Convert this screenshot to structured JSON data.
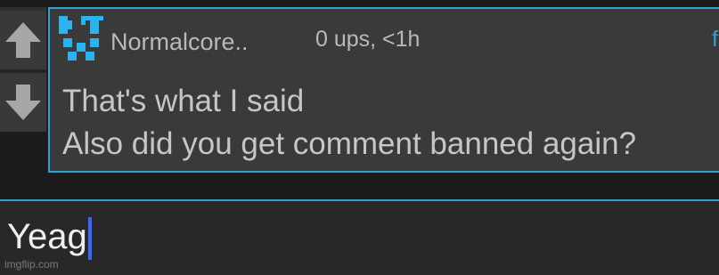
{
  "colors": {
    "accent": "#2aa3d8",
    "card_bg": "#3a3a3a",
    "input_bg": "#282828",
    "caret": "#3a66ff"
  },
  "vote": {
    "up_icon": "arrow-up-icon",
    "down_icon": "arrow-down-icon"
  },
  "comment": {
    "username": "Normalcore..",
    "meta": "0 ups, <1h",
    "flag_label": "f",
    "lines": [
      "That's what I said",
      "Also did you get comment banned again?"
    ]
  },
  "reply_input": {
    "value": "Yeag"
  },
  "watermark": "imgflip.com"
}
